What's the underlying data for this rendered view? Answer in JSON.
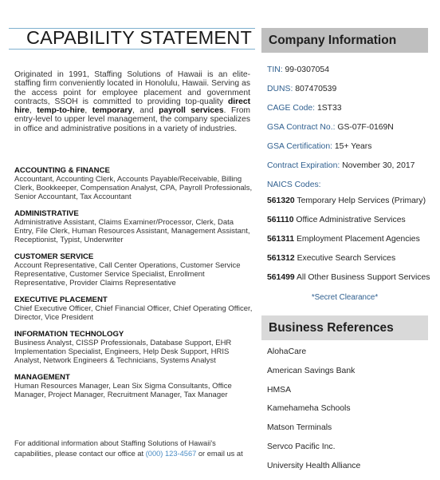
{
  "title": "CAPABILITY STATEMENT",
  "intro": {
    "p1": "Originated in 1991, Staffing Solutions of Hawaii is an elite-staffing firm conveniently located in Honolulu, Hawaii. Serving as the access point for employee placement and government contracts, SSOH is committed to providing top-quality ",
    "b1": "direct hire",
    "s1": ", ",
    "b2": "temp-to-hire",
    "s2": ", ",
    "b3": "temporary",
    "s3": ", and ",
    "b4": "payroll services",
    "p2": ". From entry-level to upper level management, the company specializes in office and administrative positions in a variety of industries."
  },
  "categories": [
    {
      "title": "ACCOUNTING & FINANCE",
      "body": "Accountant, Accounting Clerk, Accounts Payable/Receivable, Billing Clerk, Bookkeeper, Compensation Analyst, CPA, Payroll Professionals, Senior Accountant, Tax Accountant"
    },
    {
      "title": "ADMINISTRATIVE",
      "body": "Administrative Assistant, Claims Examiner/Processor, Clerk, Data Entry, File Clerk, Human Resources Assistant, Management Assistant, Receptionist, Typist, Underwriter"
    },
    {
      "title": "CUSTOMER SERVICE",
      "body": "Account Representative, Call Center Operations, Customer Service Representative, Customer Service Specialist, Enrollment Representative, Provider Claims Representative"
    },
    {
      "title": "EXECUTIVE PLACEMENT",
      "body": "Chief Executive Officer, Chief Financial Officer, Chief Operating Officer, Director, Vice President"
    },
    {
      "title": "INFORMATION TECHNOLOGY",
      "body": "Business Analyst, CISSP Professionals, Database Support, EHR Implementation Specialist, Engineers, Help Desk Support, HRIS Analyst, Network Engineers & Technicians, Systems Analyst"
    },
    {
      "title": "MANAGEMENT",
      "body": "Human Resources Manager, Lean Six Sigma Consultants, Office Manager, Project Manager, Recruitment Manager, Tax Manager"
    }
  ],
  "footer": {
    "text1": "For additional information about Staffing Solutions of Hawaii's capabilities, please contact our office at ",
    "phone": "(000) 123-4567",
    "text2": " or email us at"
  },
  "company_info": {
    "heading": "Company Information",
    "rows": [
      {
        "label": "TIN:",
        "value": " 99-0307054"
      },
      {
        "label": "DUNS:",
        "value": " 807470539"
      },
      {
        "label": "CAGE Code:",
        "value": " 1ST33"
      },
      {
        "label": "GSA Contract No.:",
        "value": " GS-07F-0169N"
      },
      {
        "label": "GSA Certification:",
        "value": " 15+ Years"
      },
      {
        "label": "Contract Expiration:",
        "value": " November 30, 2017"
      },
      {
        "label": "NAICS Codes:",
        "value": ""
      }
    ],
    "naics": [
      {
        "code": "561320",
        "desc": " Temporary Help Services (Primary)"
      },
      {
        "code": "561110",
        "desc": " Office Administrative Services"
      },
      {
        "code": "561311",
        "desc": " Employment Placement Agencies"
      },
      {
        "code": "561312",
        "desc": " Executive Search Services"
      },
      {
        "code": "561499",
        "desc": " All Other Business Support Services"
      }
    ],
    "clearance": "*Secret Clearance*"
  },
  "references": {
    "heading": "Business References",
    "items": [
      "AlohaCare",
      "American Savings Bank",
      "HMSA",
      "Kamehameha Schools",
      "Matson Terminals",
      "Servco Pacific Inc.",
      "University Health Alliance"
    ]
  }
}
